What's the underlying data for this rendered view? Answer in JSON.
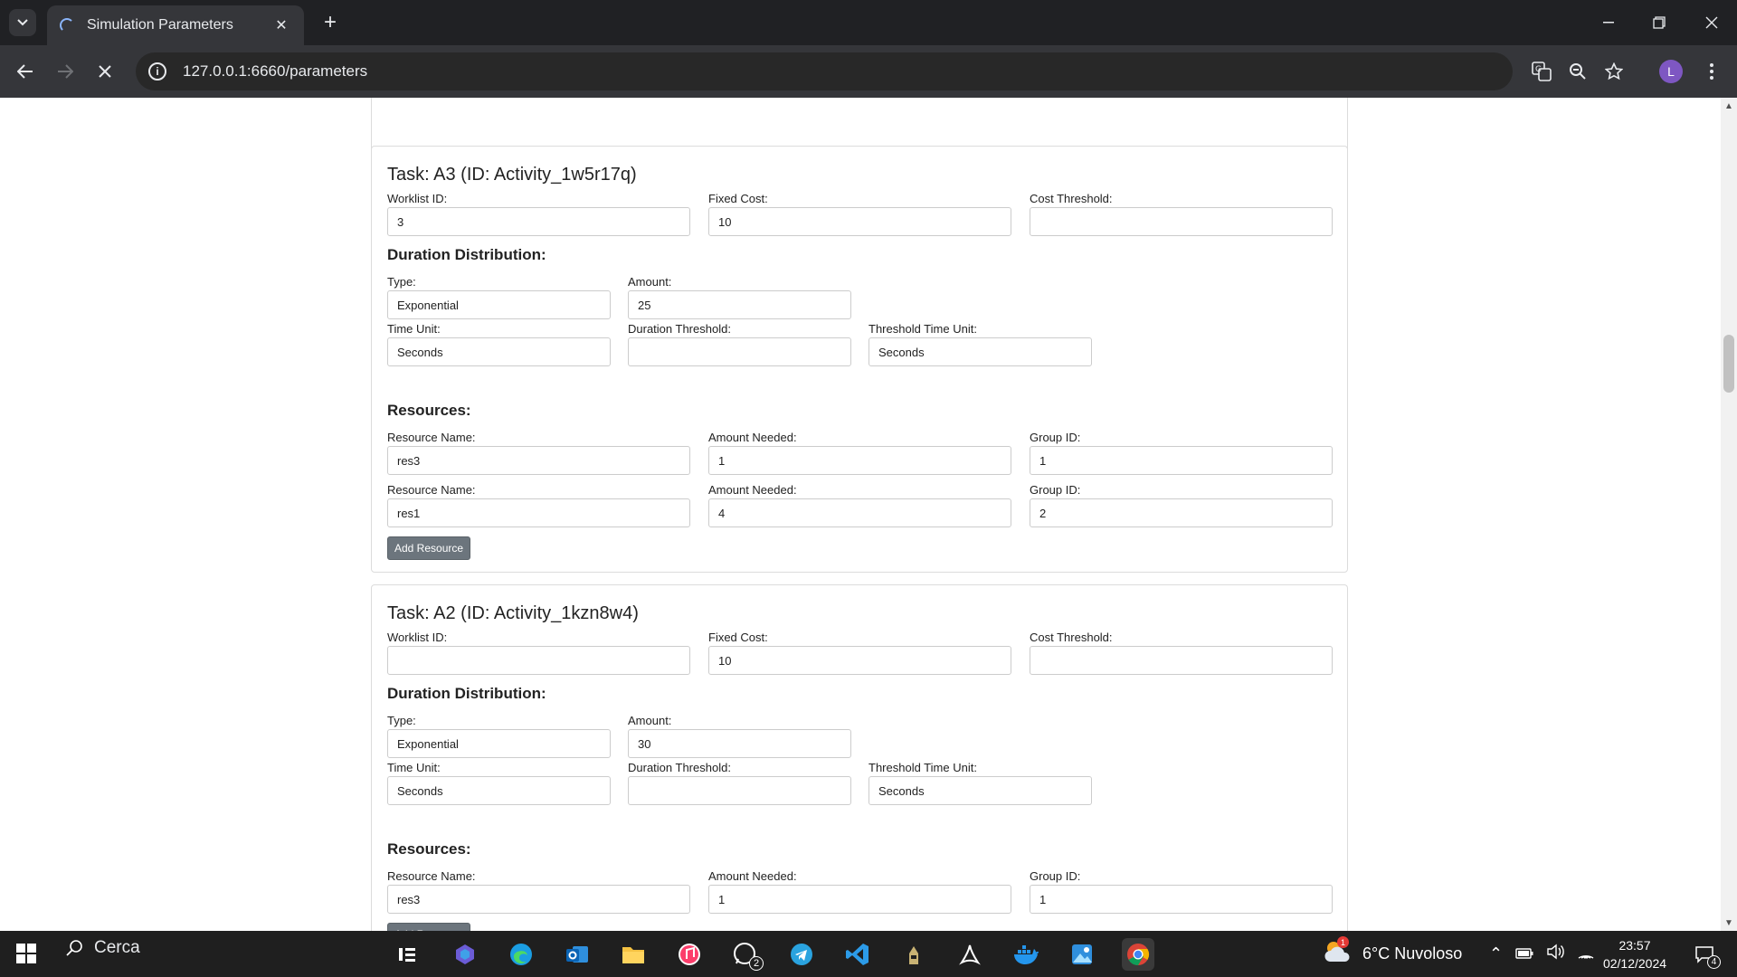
{
  "browser": {
    "tab_title": "Simulation Parameters",
    "url": "127.0.0.1:6660/parameters",
    "avatar_letter": "L"
  },
  "page": {
    "add_resource_label": "Add Resource",
    "tasks": [
      {
        "title": "Task: A3 (ID: Activity_1w5r17q)",
        "worklist_label": "Worklist ID:",
        "worklist_value": "3",
        "fixed_cost_label": "Fixed Cost:",
        "fixed_cost_value": "10",
        "cost_threshold_label": "Cost Threshold:",
        "cost_threshold_value": "",
        "duration_title": "Duration Distribution:",
        "type_label": "Type:",
        "type_value": "Exponential",
        "amount_label": "Amount:",
        "amount_value": "25",
        "time_unit_label": "Time Unit:",
        "time_unit_value": "Seconds",
        "duration_threshold_label": "Duration Threshold:",
        "duration_threshold_value": "",
        "threshold_time_unit_label": "Threshold Time Unit:",
        "threshold_time_unit_value": "Seconds",
        "resources_title": "Resources:",
        "resource_name_label": "Resource Name:",
        "amount_needed_label": "Amount Needed:",
        "group_id_label": "Group ID:",
        "resources": [
          {
            "name": "res3",
            "amount": "1",
            "group": "1"
          },
          {
            "name": "res1",
            "amount": "4",
            "group": "2"
          }
        ]
      },
      {
        "title": "Task: A2 (ID: Activity_1kzn8w4)",
        "worklist_label": "Worklist ID:",
        "worklist_value": "",
        "fixed_cost_label": "Fixed Cost:",
        "fixed_cost_value": "10",
        "cost_threshold_label": "Cost Threshold:",
        "cost_threshold_value": "",
        "duration_title": "Duration Distribution:",
        "type_label": "Type:",
        "type_value": "Exponential",
        "amount_label": "Amount:",
        "amount_value": "30",
        "time_unit_label": "Time Unit:",
        "time_unit_value": "Seconds",
        "duration_threshold_label": "Duration Threshold:",
        "duration_threshold_value": "",
        "threshold_time_unit_label": "Threshold Time Unit:",
        "threshold_time_unit_value": "Seconds",
        "resources_title": "Resources:",
        "resource_name_label": "Resource Name:",
        "amount_needed_label": "Amount Needed:",
        "group_id_label": "Group ID:",
        "resources": [
          {
            "name": "res3",
            "amount": "1",
            "group": "1"
          }
        ]
      }
    ]
  },
  "taskbar": {
    "search_label": "Cerca",
    "weather": "6°C  Nuvoloso",
    "weather_badge": "1",
    "whatsapp_badge": "2",
    "time": "23:57",
    "date": "02/12/2024",
    "notifications_badge": "4"
  }
}
